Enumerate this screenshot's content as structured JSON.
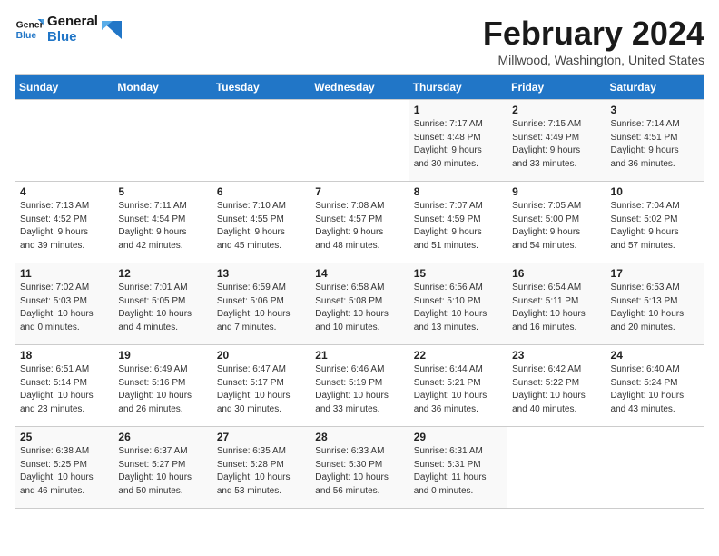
{
  "logo": {
    "line1": "General",
    "line2": "Blue"
  },
  "title": "February 2024",
  "location": "Millwood, Washington, United States",
  "days_of_week": [
    "Sunday",
    "Monday",
    "Tuesday",
    "Wednesday",
    "Thursday",
    "Friday",
    "Saturday"
  ],
  "weeks": [
    [
      {
        "day": "",
        "info": ""
      },
      {
        "day": "",
        "info": ""
      },
      {
        "day": "",
        "info": ""
      },
      {
        "day": "",
        "info": ""
      },
      {
        "day": "1",
        "info": "Sunrise: 7:17 AM\nSunset: 4:48 PM\nDaylight: 9 hours\nand 30 minutes."
      },
      {
        "day": "2",
        "info": "Sunrise: 7:15 AM\nSunset: 4:49 PM\nDaylight: 9 hours\nand 33 minutes."
      },
      {
        "day": "3",
        "info": "Sunrise: 7:14 AM\nSunset: 4:51 PM\nDaylight: 9 hours\nand 36 minutes."
      }
    ],
    [
      {
        "day": "4",
        "info": "Sunrise: 7:13 AM\nSunset: 4:52 PM\nDaylight: 9 hours\nand 39 minutes."
      },
      {
        "day": "5",
        "info": "Sunrise: 7:11 AM\nSunset: 4:54 PM\nDaylight: 9 hours\nand 42 minutes."
      },
      {
        "day": "6",
        "info": "Sunrise: 7:10 AM\nSunset: 4:55 PM\nDaylight: 9 hours\nand 45 minutes."
      },
      {
        "day": "7",
        "info": "Sunrise: 7:08 AM\nSunset: 4:57 PM\nDaylight: 9 hours\nand 48 minutes."
      },
      {
        "day": "8",
        "info": "Sunrise: 7:07 AM\nSunset: 4:59 PM\nDaylight: 9 hours\nand 51 minutes."
      },
      {
        "day": "9",
        "info": "Sunrise: 7:05 AM\nSunset: 5:00 PM\nDaylight: 9 hours\nand 54 minutes."
      },
      {
        "day": "10",
        "info": "Sunrise: 7:04 AM\nSunset: 5:02 PM\nDaylight: 9 hours\nand 57 minutes."
      }
    ],
    [
      {
        "day": "11",
        "info": "Sunrise: 7:02 AM\nSunset: 5:03 PM\nDaylight: 10 hours\nand 0 minutes."
      },
      {
        "day": "12",
        "info": "Sunrise: 7:01 AM\nSunset: 5:05 PM\nDaylight: 10 hours\nand 4 minutes."
      },
      {
        "day": "13",
        "info": "Sunrise: 6:59 AM\nSunset: 5:06 PM\nDaylight: 10 hours\nand 7 minutes."
      },
      {
        "day": "14",
        "info": "Sunrise: 6:58 AM\nSunset: 5:08 PM\nDaylight: 10 hours\nand 10 minutes."
      },
      {
        "day": "15",
        "info": "Sunrise: 6:56 AM\nSunset: 5:10 PM\nDaylight: 10 hours\nand 13 minutes."
      },
      {
        "day": "16",
        "info": "Sunrise: 6:54 AM\nSunset: 5:11 PM\nDaylight: 10 hours\nand 16 minutes."
      },
      {
        "day": "17",
        "info": "Sunrise: 6:53 AM\nSunset: 5:13 PM\nDaylight: 10 hours\nand 20 minutes."
      }
    ],
    [
      {
        "day": "18",
        "info": "Sunrise: 6:51 AM\nSunset: 5:14 PM\nDaylight: 10 hours\nand 23 minutes."
      },
      {
        "day": "19",
        "info": "Sunrise: 6:49 AM\nSunset: 5:16 PM\nDaylight: 10 hours\nand 26 minutes."
      },
      {
        "day": "20",
        "info": "Sunrise: 6:47 AM\nSunset: 5:17 PM\nDaylight: 10 hours\nand 30 minutes."
      },
      {
        "day": "21",
        "info": "Sunrise: 6:46 AM\nSunset: 5:19 PM\nDaylight: 10 hours\nand 33 minutes."
      },
      {
        "day": "22",
        "info": "Sunrise: 6:44 AM\nSunset: 5:21 PM\nDaylight: 10 hours\nand 36 minutes."
      },
      {
        "day": "23",
        "info": "Sunrise: 6:42 AM\nSunset: 5:22 PM\nDaylight: 10 hours\nand 40 minutes."
      },
      {
        "day": "24",
        "info": "Sunrise: 6:40 AM\nSunset: 5:24 PM\nDaylight: 10 hours\nand 43 minutes."
      }
    ],
    [
      {
        "day": "25",
        "info": "Sunrise: 6:38 AM\nSunset: 5:25 PM\nDaylight: 10 hours\nand 46 minutes."
      },
      {
        "day": "26",
        "info": "Sunrise: 6:37 AM\nSunset: 5:27 PM\nDaylight: 10 hours\nand 50 minutes."
      },
      {
        "day": "27",
        "info": "Sunrise: 6:35 AM\nSunset: 5:28 PM\nDaylight: 10 hours\nand 53 minutes."
      },
      {
        "day": "28",
        "info": "Sunrise: 6:33 AM\nSunset: 5:30 PM\nDaylight: 10 hours\nand 56 minutes."
      },
      {
        "day": "29",
        "info": "Sunrise: 6:31 AM\nSunset: 5:31 PM\nDaylight: 11 hours\nand 0 minutes."
      },
      {
        "day": "",
        "info": ""
      },
      {
        "day": "",
        "info": ""
      }
    ]
  ]
}
